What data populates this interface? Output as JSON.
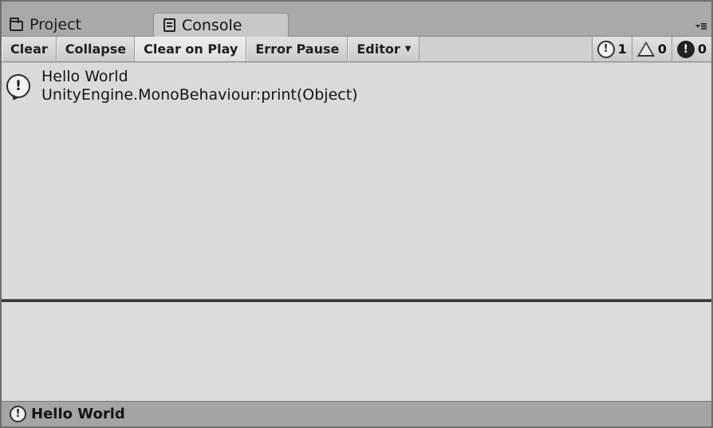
{
  "tabs": {
    "project_label": "Project",
    "console_label": "Console"
  },
  "toolbar": {
    "clear": "Clear",
    "collapse": "Collapse",
    "clear_on_play": "Clear on Play",
    "error_pause": "Error Pause",
    "editor": "Editor",
    "log_count": "1",
    "warning_count": "0",
    "error_count": "0"
  },
  "log": {
    "entries": [
      {
        "level": "info",
        "message": "Hello World",
        "stack": "UnityEngine.MonoBehaviour:print(Object)"
      }
    ]
  },
  "status": {
    "text": "Hello World"
  },
  "icons": {
    "info": "!",
    "error": "!"
  }
}
